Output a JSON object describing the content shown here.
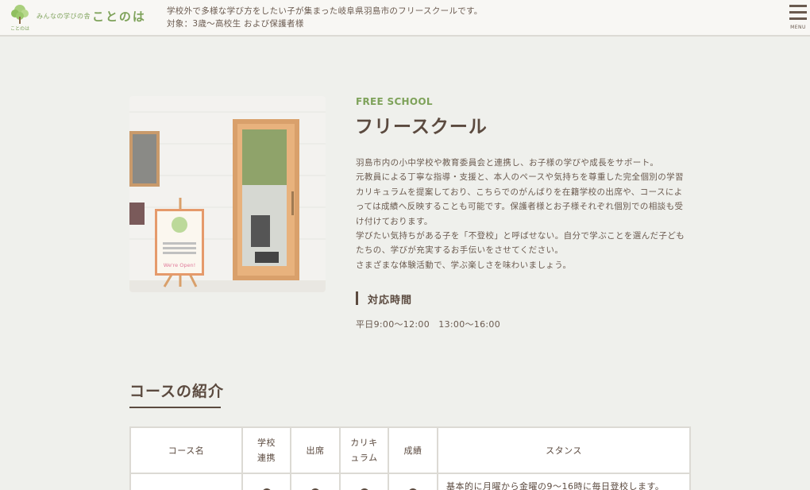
{
  "header": {
    "logo_sub": "みんなの学びの舎",
    "logo_main": "ことのは",
    "logo_tree_caption": "ことのは",
    "desc_line1": "学校外で多様な学び方をしたい子が集まった岐阜県羽島市のフリースクールです。",
    "desc_line2": "対象：3歳〜高校生 および保護者様",
    "menu_label": "MENU"
  },
  "photo": {
    "sign_text": "We're Open!"
  },
  "main": {
    "eyebrow": "FREE SCHOOL",
    "title": "フリースクール",
    "paragraphs": [
      "羽島市内の小中学校や教育委員会と連携し、お子様の学びや成長をサポート。",
      "元教員による丁寧な指導・支援と、本人のペースや気持ちを尊重した完全個別の学習カリキュラムを提案しており、こちらでのがんばりを在籍学校の出席や、コースによっては成績へ反映することも可能です。保護者様とお子様それぞれ個別での相談も受け付けております。",
      "学びたい気持ちがある子を「不登校」と呼ばせない。自分で学ぶことを選んだ子どもたちの、学びが充実するお手伝いをさせてください。",
      "さまざまな体験活動で、学ぶ楽しさを味わいましょう。"
    ],
    "hours_heading": "対応時間",
    "hours_text": "平日9:00〜12:00　13:00〜16:00"
  },
  "courses": {
    "heading": "コースの紹介",
    "columns": [
      "コース名",
      "学校\n連携",
      "出席",
      "カリキ\nュラム",
      "成績",
      "スタンス"
    ],
    "row1_stance": "基本的に月曜から金曜の9〜16時に毎日登校します。"
  },
  "colors": {
    "accent_green": "#7ea25a",
    "text_brown": "#5b4a3f",
    "background": "#eff0ec"
  }
}
